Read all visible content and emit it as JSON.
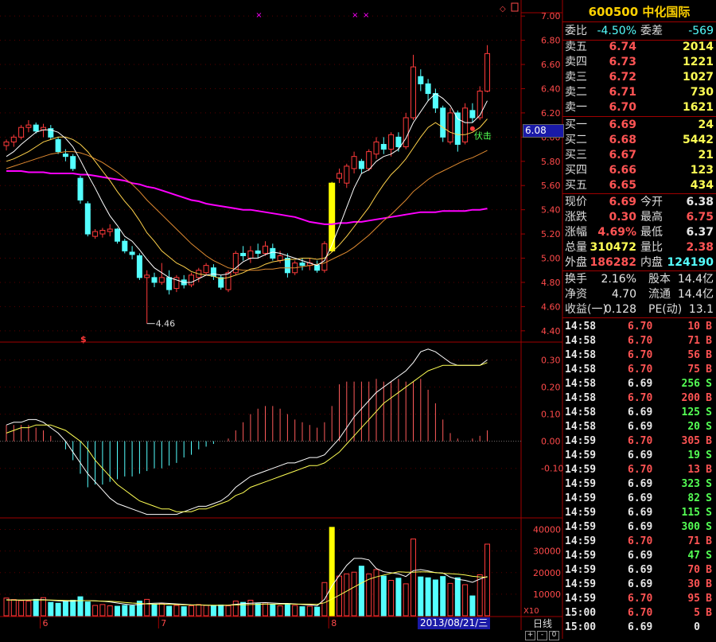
{
  "stock": {
    "code": "600500",
    "name": "中化国际",
    "header": "600500 中化国际"
  },
  "colors": {
    "up": "#ff3a3a",
    "down": "#54ffff",
    "ma5": "#ffffff",
    "ma10": "#ffd24a",
    "ma20": "#e08a30",
    "ma60": "#ff00ff",
    "grid": "#a00000",
    "highlight": "#ffff00"
  },
  "order_book": {
    "weibi_label": "委比",
    "weibi": "-4.50%",
    "weicha_label": "委差",
    "weicha": "-569",
    "asks": [
      {
        "label": "卖五",
        "price": "6.74",
        "vol": "2014"
      },
      {
        "label": "卖四",
        "price": "6.73",
        "vol": "1221"
      },
      {
        "label": "卖三",
        "price": "6.72",
        "vol": "1027"
      },
      {
        "label": "卖二",
        "price": "6.71",
        "vol": "730"
      },
      {
        "label": "卖一",
        "price": "6.70",
        "vol": "1621"
      }
    ],
    "bids": [
      {
        "label": "买一",
        "price": "6.69",
        "vol": "24"
      },
      {
        "label": "买二",
        "price": "6.68",
        "vol": "5442"
      },
      {
        "label": "买三",
        "price": "6.67",
        "vol": "21"
      },
      {
        "label": "买四",
        "price": "6.66",
        "vol": "123"
      },
      {
        "label": "买五",
        "price": "6.65",
        "vol": "434"
      }
    ]
  },
  "quote": [
    {
      "l1": "现价",
      "v1": "6.69",
      "c1": "red",
      "l2": "今开",
      "v2": "6.38",
      "c2": "white"
    },
    {
      "l1": "涨跌",
      "v1": "0.30",
      "c1": "red",
      "l2": "最高",
      "v2": "6.75",
      "c2": "red"
    },
    {
      "l1": "涨幅",
      "v1": "4.69%",
      "c1": "red",
      "l2": "最低",
      "v2": "6.37",
      "c2": "white"
    },
    {
      "l1": "总量",
      "v1": "310472",
      "c1": "yellow",
      "l2": "量比",
      "v2": "2.38",
      "c2": "red"
    },
    {
      "l1": "外盘",
      "v1": "186282",
      "c1": "red",
      "l2": "内盘",
      "v2": "124190",
      "c2": "cyan"
    }
  ],
  "fundamentals": [
    {
      "l1": "换手",
      "v1": "2.16%",
      "l2": "股本",
      "v2": "14.4亿"
    },
    {
      "l1": "净资",
      "v1": "4.70",
      "l2": "流通",
      "v2": "14.4亿"
    },
    {
      "l1": "收益(一)",
      "v1": "0.128",
      "l2": "PE(动)",
      "v2": "13.1"
    }
  ],
  "ticks": [
    {
      "time": "14:58",
      "price": "6.70",
      "vol": "10",
      "bs": "B"
    },
    {
      "time": "14:58",
      "price": "6.70",
      "vol": "71",
      "bs": "B"
    },
    {
      "time": "14:58",
      "price": "6.70",
      "vol": "56",
      "bs": "B"
    },
    {
      "time": "14:58",
      "price": "6.70",
      "vol": "75",
      "bs": "B"
    },
    {
      "time": "14:58",
      "price": "6.69",
      "vol": "256",
      "bs": "S"
    },
    {
      "time": "14:58",
      "price": "6.70",
      "vol": "200",
      "bs": "B"
    },
    {
      "time": "14:58",
      "price": "6.69",
      "vol": "125",
      "bs": "S"
    },
    {
      "time": "14:58",
      "price": "6.69",
      "vol": "20",
      "bs": "S"
    },
    {
      "time": "14:59",
      "price": "6.70",
      "vol": "305",
      "bs": "B"
    },
    {
      "time": "14:59",
      "price": "6.69",
      "vol": "19",
      "bs": "S"
    },
    {
      "time": "14:59",
      "price": "6.70",
      "vol": "13",
      "bs": "B"
    },
    {
      "time": "14:59",
      "price": "6.69",
      "vol": "323",
      "bs": "S"
    },
    {
      "time": "14:59",
      "price": "6.69",
      "vol": "82",
      "bs": "S"
    },
    {
      "time": "14:59",
      "price": "6.69",
      "vol": "115",
      "bs": "S"
    },
    {
      "time": "14:59",
      "price": "6.69",
      "vol": "300",
      "bs": "S"
    },
    {
      "time": "14:59",
      "price": "6.70",
      "vol": "71",
      "bs": "B"
    },
    {
      "time": "14:59",
      "price": "6.69",
      "vol": "47",
      "bs": "S"
    },
    {
      "time": "14:59",
      "price": "6.69",
      "vol": "70",
      "bs": "B"
    },
    {
      "time": "14:59",
      "price": "6.69",
      "vol": "30",
      "bs": "B"
    },
    {
      "time": "14:59",
      "price": "6.70",
      "vol": "95",
      "bs": "B"
    },
    {
      "time": "15:00",
      "price": "6.70",
      "vol": "5",
      "bs": "B"
    },
    {
      "time": "15:00",
      "price": "6.69",
      "vol": "0",
      "bs": ""
    }
  ],
  "chart_ui": {
    "current_price_tag": "6.08",
    "cursor_date": "2013/08/21/三",
    "period_button": "日线",
    "zoom_plus": "+",
    "zoom_minus": "-",
    "zoom_reset": "0",
    "vol_unit": "X10",
    "low_marker": "4.46",
    "signal_label": "伏击",
    "signal_dollar": "$"
  },
  "chart_data": {
    "type": "candlestick",
    "price_axis": {
      "ticks": [
        4.4,
        4.6,
        4.8,
        5.0,
        5.2,
        5.4,
        5.6,
        5.8,
        6.0,
        6.2,
        6.4,
        6.6,
        6.8,
        7.0
      ],
      "range": [
        4.32,
        7.08
      ]
    },
    "macd_axis": {
      "ticks": [
        0.3,
        0.2,
        0.1,
        0.0,
        -0.1
      ],
      "range": [
        -0.28,
        0.36
      ]
    },
    "volume_axis": {
      "ticks": [
        10000,
        20000,
        30000,
        40000
      ],
      "range": [
        0,
        45000
      ]
    },
    "month_labels": [
      {
        "index": 5,
        "label": "6"
      },
      {
        "index": 21,
        "label": "7"
      },
      {
        "index": 44,
        "label": "8"
      }
    ],
    "candles": [
      [
        5.93,
        5.98,
        5.89,
        5.96
      ],
      [
        5.96,
        6.02,
        5.92,
        6.0
      ],
      [
        6.0,
        6.1,
        5.98,
        6.08
      ],
      [
        6.08,
        6.14,
        6.04,
        6.1
      ],
      [
        6.1,
        6.12,
        6.03,
        6.05
      ],
      [
        6.06,
        6.11,
        6.0,
        6.08
      ],
      [
        6.07,
        6.1,
        5.98,
        6.0
      ],
      [
        5.98,
        6.0,
        5.86,
        5.88
      ],
      [
        5.86,
        5.9,
        5.8,
        5.84
      ],
      [
        5.84,
        5.86,
        5.72,
        5.74
      ],
      [
        5.66,
        5.68,
        5.45,
        5.48
      ],
      [
        5.45,
        5.47,
        5.18,
        5.2
      ],
      [
        5.18,
        5.24,
        5.16,
        5.22
      ],
      [
        5.2,
        5.25,
        5.17,
        5.23
      ],
      [
        5.22,
        5.28,
        5.18,
        5.24
      ],
      [
        5.24,
        5.25,
        5.12,
        5.14
      ],
      [
        5.14,
        5.16,
        5.04,
        5.06
      ],
      [
        5.05,
        5.1,
        4.99,
        5.03
      ],
      [
        5.02,
        5.04,
        4.82,
        4.84
      ],
      [
        4.84,
        4.9,
        4.46,
        4.86
      ],
      [
        4.84,
        4.88,
        4.76,
        4.8
      ],
      [
        4.8,
        4.96,
        4.78,
        4.84
      ],
      [
        4.84,
        4.9,
        4.7,
        4.74
      ],
      [
        4.75,
        4.86,
        4.72,
        4.84
      ],
      [
        4.82,
        4.86,
        4.75,
        4.78
      ],
      [
        4.78,
        4.88,
        4.76,
        4.86
      ],
      [
        4.84,
        4.92,
        4.8,
        4.9
      ],
      [
        4.88,
        4.96,
        4.86,
        4.94
      ],
      [
        4.92,
        4.95,
        4.82,
        4.85
      ],
      [
        4.84,
        4.86,
        4.74,
        4.76
      ],
      [
        4.74,
        4.9,
        4.72,
        4.88
      ],
      [
        4.88,
        5.06,
        4.86,
        5.04
      ],
      [
        5.04,
        5.1,
        4.98,
        5.02
      ],
      [
        5.0,
        5.1,
        4.96,
        5.06
      ],
      [
        5.06,
        5.12,
        5.0,
        5.04
      ],
      [
        5.04,
        5.14,
        5.02,
        5.1
      ],
      [
        5.08,
        5.12,
        4.98,
        5.0
      ],
      [
        4.98,
        5.06,
        4.96,
        5.02
      ],
      [
        5.0,
        5.04,
        4.84,
        4.88
      ],
      [
        4.88,
        4.98,
        4.86,
        4.96
      ],
      [
        4.96,
        5.0,
        4.9,
        4.94
      ],
      [
        4.94,
        5.0,
        4.9,
        4.96
      ],
      [
        4.94,
        4.98,
        4.88,
        4.9
      ],
      [
        4.9,
        5.14,
        4.88,
        5.12
      ],
      [
        5.06,
        5.63,
        5.05,
        5.62
      ],
      [
        5.66,
        5.74,
        5.62,
        5.7
      ],
      [
        5.62,
        5.78,
        5.58,
        5.76
      ],
      [
        5.74,
        5.88,
        5.7,
        5.84
      ],
      [
        5.8,
        5.82,
        5.7,
        5.74
      ],
      [
        5.74,
        5.9,
        5.72,
        5.88
      ],
      [
        5.86,
        6.0,
        5.82,
        5.96
      ],
      [
        5.94,
        6.0,
        5.86,
        5.9
      ],
      [
        5.9,
        6.04,
        5.84,
        6.02
      ],
      [
        6.0,
        6.04,
        5.88,
        5.92
      ],
      [
        5.92,
        6.2,
        5.9,
        6.16
      ],
      [
        6.16,
        6.68,
        6.14,
        6.58
      ],
      [
        6.5,
        6.56,
        6.38,
        6.44
      ],
      [
        6.44,
        6.48,
        6.3,
        6.36
      ],
      [
        6.36,
        6.4,
        6.2,
        6.24
      ],
      [
        6.24,
        6.26,
        5.96,
        6.0
      ],
      [
        5.96,
        6.24,
        5.94,
        6.2
      ],
      [
        6.2,
        6.22,
        5.88,
        5.94
      ],
      [
        5.96,
        6.28,
        5.94,
        6.24
      ],
      [
        6.22,
        6.28,
        6.12,
        6.16
      ],
      [
        6.16,
        6.42,
        6.14,
        6.38
      ],
      [
        6.38,
        6.76,
        6.37,
        6.69
      ]
    ],
    "ma5": [
      5.84,
      5.88,
      5.94,
      5.99,
      6.04,
      6.06,
      6.06,
      6.04,
      5.99,
      5.92,
      5.81,
      5.69,
      5.58,
      5.46,
      5.35,
      5.27,
      5.18,
      5.14,
      5.07,
      4.99,
      4.92,
      4.88,
      4.84,
      4.82,
      4.8,
      4.8,
      4.83,
      4.86,
      4.87,
      4.86,
      4.87,
      4.92,
      4.97,
      5.0,
      5.0,
      5.03,
      5.05,
      5.04,
      5.02,
      5.0,
      4.98,
      4.96,
      4.94,
      4.98,
      5.11,
      5.26,
      5.42,
      5.58,
      5.7,
      5.73,
      5.8,
      5.84,
      5.86,
      5.9,
      5.99,
      6.12,
      6.21,
      6.3,
      6.36,
      6.32,
      6.26,
      6.15,
      6.12,
      6.12,
      6.18,
      6.3
    ],
    "ma10": [
      5.8,
      5.82,
      5.85,
      5.88,
      5.92,
      5.96,
      5.98,
      6.0,
      6.0,
      5.98,
      5.94,
      5.88,
      5.8,
      5.72,
      5.64,
      5.55,
      5.47,
      5.4,
      5.31,
      5.21,
      5.14,
      5.06,
      5.01,
      4.96,
      4.93,
      4.89,
      4.87,
      4.86,
      4.85,
      4.83,
      4.84,
      4.86,
      4.88,
      4.91,
      4.92,
      4.95,
      4.97,
      4.98,
      4.99,
      4.99,
      5.0,
      5.0,
      4.99,
      5.0,
      5.05,
      5.11,
      5.18,
      5.26,
      5.34,
      5.42,
      5.52,
      5.61,
      5.69,
      5.75,
      5.82,
      5.91,
      6.0,
      6.08,
      6.12,
      6.08,
      6.04,
      6.02,
      6.02,
      6.04,
      6.08,
      6.15
    ],
    "ma20": [
      5.74,
      5.76,
      5.78,
      5.8,
      5.82,
      5.84,
      5.86,
      5.87,
      5.88,
      5.88,
      5.87,
      5.85,
      5.82,
      5.79,
      5.75,
      5.71,
      5.66,
      5.61,
      5.55,
      5.48,
      5.42,
      5.36,
      5.3,
      5.24,
      5.18,
      5.12,
      5.07,
      5.02,
      4.98,
      4.95,
      4.92,
      4.91,
      4.9,
      4.9,
      4.9,
      4.91,
      4.91,
      4.92,
      4.92,
      4.92,
      4.93,
      4.94,
      4.95,
      4.96,
      4.99,
      5.02,
      5.05,
      5.09,
      5.14,
      5.19,
      5.25,
      5.31,
      5.36,
      5.42,
      5.48,
      5.55,
      5.6,
      5.65,
      5.69,
      5.72,
      5.75,
      5.78,
      5.81,
      5.83,
      5.86,
      5.89
    ],
    "ma60": [
      5.72,
      5.72,
      5.72,
      5.71,
      5.71,
      5.71,
      5.7,
      5.7,
      5.7,
      5.7,
      5.69,
      5.69,
      5.68,
      5.67,
      5.66,
      5.65,
      5.64,
      5.62,
      5.61,
      5.59,
      5.58,
      5.56,
      5.54,
      5.52,
      5.5,
      5.48,
      5.47,
      5.45,
      5.44,
      5.43,
      5.42,
      5.41,
      5.4,
      5.4,
      5.39,
      5.38,
      5.37,
      5.36,
      5.35,
      5.34,
      5.32,
      5.3,
      5.29,
      5.28,
      5.28,
      5.29,
      5.29,
      5.3,
      5.3,
      5.31,
      5.32,
      5.33,
      5.34,
      5.35,
      5.36,
      5.37,
      5.38,
      5.38,
      5.38,
      5.39,
      5.39,
      5.39,
      5.39,
      5.4,
      5.4,
      5.41
    ],
    "macd_hist": [
      0.06,
      0.06,
      0.06,
      0.06,
      0.05,
      0.04,
      0.02,
      0.0,
      -0.03,
      -0.07,
      -0.12,
      -0.17,
      -0.16,
      -0.16,
      -0.15,
      -0.14,
      -0.13,
      -0.13,
      -0.12,
      -0.11,
      -0.1,
      -0.1,
      -0.09,
      -0.08,
      -0.06,
      -0.05,
      -0.03,
      -0.02,
      -0.01,
      0.0,
      0.01,
      0.04,
      0.07,
      0.1,
      0.12,
      0.13,
      0.13,
      0.12,
      0.1,
      0.08,
      0.07,
      0.06,
      0.05,
      0.07,
      0.13,
      0.21,
      0.22,
      0.22,
      0.22,
      0.22,
      0.23,
      0.22,
      0.22,
      0.23,
      0.22,
      0.22,
      0.23,
      0.19,
      0.14,
      0.08,
      0.03,
      0.01,
      0.0,
      0.01,
      0.02,
      0.04
    ],
    "dif": [
      0.06,
      0.07,
      0.07,
      0.08,
      0.08,
      0.07,
      0.05,
      0.03,
      0.0,
      -0.04,
      -0.08,
      -0.12,
      -0.15,
      -0.18,
      -0.21,
      -0.23,
      -0.24,
      -0.25,
      -0.26,
      -0.27,
      -0.27,
      -0.27,
      -0.27,
      -0.27,
      -0.26,
      -0.25,
      -0.24,
      -0.24,
      -0.23,
      -0.22,
      -0.2,
      -0.17,
      -0.15,
      -0.13,
      -0.12,
      -0.11,
      -0.1,
      -0.09,
      -0.08,
      -0.08,
      -0.07,
      -0.06,
      -0.06,
      -0.05,
      -0.02,
      0.01,
      0.05,
      0.09,
      0.12,
      0.15,
      0.18,
      0.2,
      0.22,
      0.24,
      0.26,
      0.29,
      0.33,
      0.34,
      0.33,
      0.31,
      0.29,
      0.28,
      0.28,
      0.28,
      0.28,
      0.3
    ],
    "dea": [
      0.03,
      0.04,
      0.05,
      0.05,
      0.06,
      0.06,
      0.06,
      0.05,
      0.04,
      0.02,
      0.0,
      -0.03,
      -0.07,
      -0.1,
      -0.13,
      -0.16,
      -0.18,
      -0.2,
      -0.22,
      -0.23,
      -0.24,
      -0.25,
      -0.25,
      -0.26,
      -0.26,
      -0.26,
      -0.25,
      -0.25,
      -0.24,
      -0.23,
      -0.22,
      -0.2,
      -0.19,
      -0.17,
      -0.16,
      -0.15,
      -0.14,
      -0.13,
      -0.12,
      -0.11,
      -0.1,
      -0.09,
      -0.09,
      -0.08,
      -0.06,
      -0.04,
      -0.01,
      0.02,
      0.05,
      0.08,
      0.11,
      0.14,
      0.16,
      0.18,
      0.2,
      0.22,
      0.24,
      0.26,
      0.27,
      0.28,
      0.28,
      0.28,
      0.28,
      0.28,
      0.28,
      0.29
    ],
    "volume": [
      8200,
      7500,
      7000,
      6800,
      7600,
      8400,
      6200,
      5800,
      6500,
      7200,
      8800,
      6400,
      4800,
      5200,
      4600,
      4400,
      4800,
      4600,
      6800,
      7600,
      5200,
      5600,
      4400,
      4800,
      4200,
      4600,
      5200,
      4800,
      4600,
      5000,
      4600,
      6800,
      6200,
      7200,
      5600,
      6000,
      5200,
      4600,
      5600,
      4800,
      4200,
      4400,
      4000,
      15400,
      41000,
      18400,
      19400,
      20200,
      23000,
      19400,
      21400,
      18400,
      16400,
      17400,
      14800,
      35600,
      18000,
      17600,
      16600,
      18200,
      15000,
      17600,
      14400,
      9200,
      19000,
      33200
    ],
    "vol_ma1": [
      7400,
      7300,
      7200,
      7300,
      7400,
      7500,
      7200,
      6900,
      6800,
      6700,
      7000,
      7000,
      6900,
      6700,
      6400,
      5900,
      5400,
      5000,
      5200,
      5600,
      5800,
      5900,
      5700,
      5500,
      5300,
      5100,
      5000,
      4900,
      4800,
      4800,
      4900,
      5300,
      5600,
      5800,
      6000,
      6100,
      5900,
      5700,
      5700,
      5500,
      5200,
      5000,
      4700,
      7600,
      13800,
      18700,
      23400,
      26600,
      26600,
      25900,
      21900,
      20400,
      19900,
      19400,
      18200,
      20900,
      21400,
      20800,
      20000,
      19800,
      17900,
      16900,
      16400,
      15500,
      17000,
      18200
    ],
    "vol_ma2": [
      7300,
      7300,
      7300,
      7300,
      7300,
      7300,
      7300,
      7200,
      7100,
      7000,
      7000,
      7000,
      6900,
      6800,
      6700,
      6500,
      6200,
      5900,
      5700,
      5500,
      5400,
      5400,
      5300,
      5200,
      5100,
      5000,
      5000,
      4900,
      4900,
      4900,
      4900,
      5000,
      5100,
      5200,
      5300,
      5400,
      5400,
      5400,
      5500,
      5400,
      5400,
      5400,
      5300,
      6000,
      7700,
      9500,
      11400,
      13300,
      15200,
      16900,
      18000,
      18900,
      19700,
      20400,
      20200,
      20200,
      20400,
      20300,
      20000,
      19700,
      19500,
      19300,
      18900,
      18300,
      18000,
      17900
    ]
  }
}
